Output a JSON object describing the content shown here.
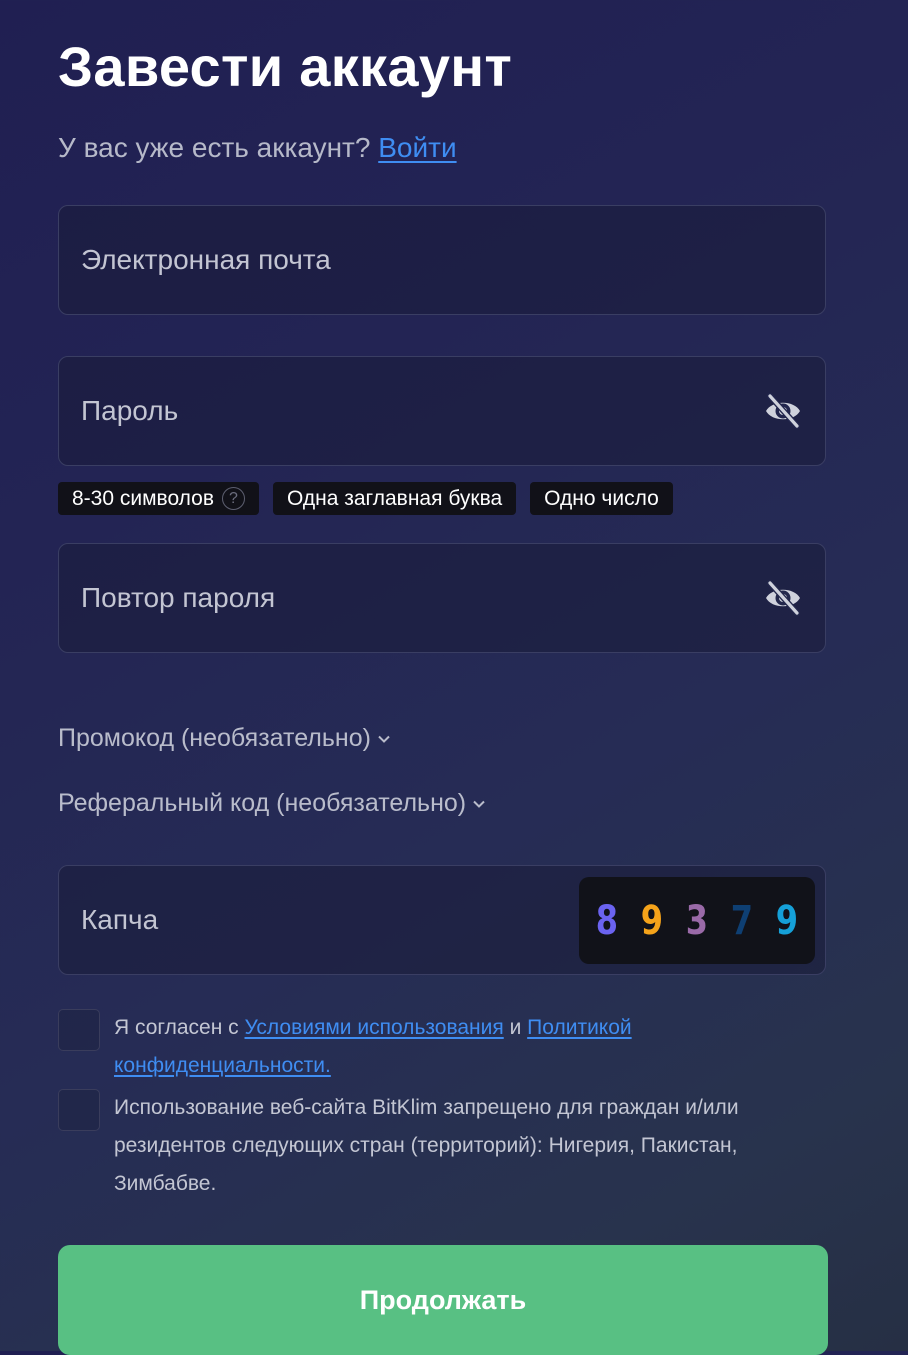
{
  "header": {
    "title": "Завести аккаунт",
    "subtitle_text": "У вас уже есть аккаунт?",
    "login_link": "Войти"
  },
  "form": {
    "email_placeholder": "Электронная почта",
    "password_placeholder": "Пароль",
    "password_requirements": [
      "8-30 символов",
      "Одна заглавная буква",
      "Одно число"
    ],
    "requirement_help_icon": "?",
    "repeat_password_placeholder": "Повтор пароля",
    "promo_label": "Промокод (необязательно)",
    "referral_label": "Реферальный код (необязательно)",
    "captcha_placeholder": "Капча",
    "captcha_digits": [
      {
        "char": "8",
        "color": "#6b63f0"
      },
      {
        "char": "9",
        "color": "#f5a31a"
      },
      {
        "char": "3",
        "color": "#9a6aa8"
      },
      {
        "char": "7",
        "color": "#0e3f73"
      },
      {
        "char": "9",
        "color": "#15a0d8"
      }
    ],
    "terms": {
      "prefix": "Я согласен с ",
      "terms_link": "Условиями использования",
      "conjunction": " и ",
      "privacy_link": "Политикой конфиденциальности.",
      "checked": false
    },
    "restriction": {
      "text": "Использование веб-сайта BitKlim запрещено для граждан и/или резидентов следующих стран (территорий): Нигерия, Пакистан, Зимбабве.",
      "checked": false
    },
    "submit_label": "Продолжать"
  },
  "icons": {
    "password_toggle": "eye-slash-icon",
    "dropdown": "chevron-down-icon"
  },
  "colors": {
    "accent_link": "#3f8df2",
    "submit_bg": "#58c083"
  }
}
